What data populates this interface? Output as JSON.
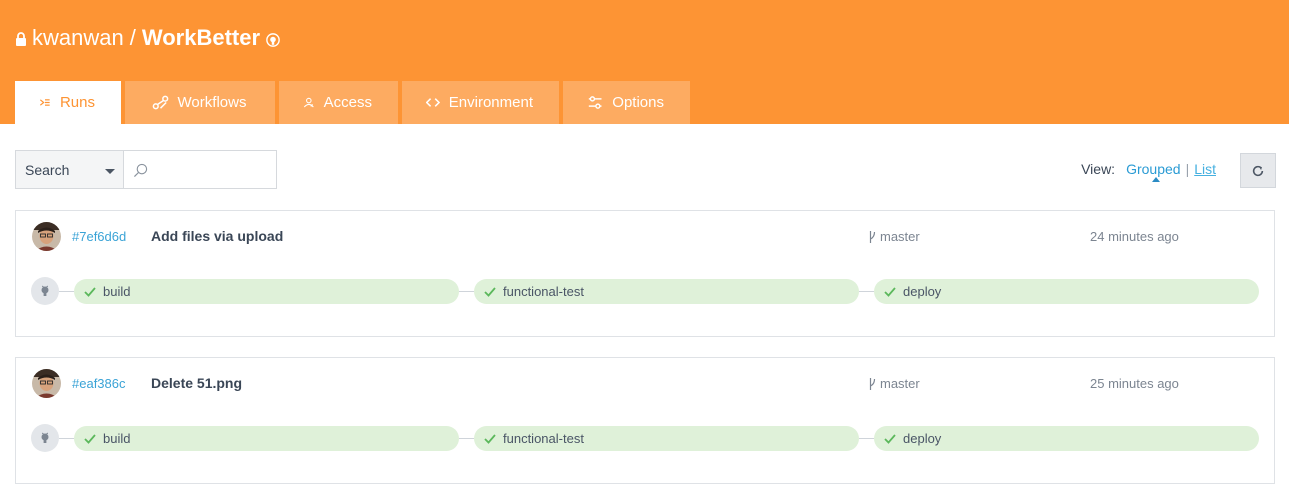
{
  "repo": {
    "owner": "kwanwan",
    "separator": "/",
    "name": "WorkBetter"
  },
  "tabs": [
    {
      "label": "Runs",
      "icon": "runs-icon",
      "active": true
    },
    {
      "label": "Workflows",
      "icon": "workflows-icon",
      "active": false
    },
    {
      "label": "Access",
      "icon": "access-icon",
      "active": false
    },
    {
      "label": "Environment",
      "icon": "code-icon",
      "active": false
    },
    {
      "label": "Options",
      "icon": "options-icon",
      "active": false
    }
  ],
  "search": {
    "select_value": "Search",
    "placeholder": "",
    "value": ""
  },
  "view": {
    "label": "View:",
    "grouped": "Grouped",
    "separator": "|",
    "list": "List",
    "selected": "Grouped"
  },
  "runs": [
    {
      "commit": "#7ef6d6d",
      "message": "Add files via upload",
      "branch": "master",
      "time": "24 minutes ago",
      "jobs": [
        {
          "name": "build",
          "status": "success"
        },
        {
          "name": "functional-test",
          "status": "success"
        },
        {
          "name": "deploy",
          "status": "success"
        }
      ]
    },
    {
      "commit": "#eaf386c",
      "message": "Delete 51.png",
      "branch": "master",
      "time": "25 minutes ago",
      "jobs": [
        {
          "name": "build",
          "status": "success"
        },
        {
          "name": "functional-test",
          "status": "success"
        },
        {
          "name": "deploy",
          "status": "success"
        }
      ]
    }
  ],
  "colors": {
    "brand": "#fd9434",
    "tab_inactive": "#fdab61",
    "link": "#3aa3d6",
    "success_bg": "#dff1d9",
    "success_check": "#5cb85c"
  }
}
